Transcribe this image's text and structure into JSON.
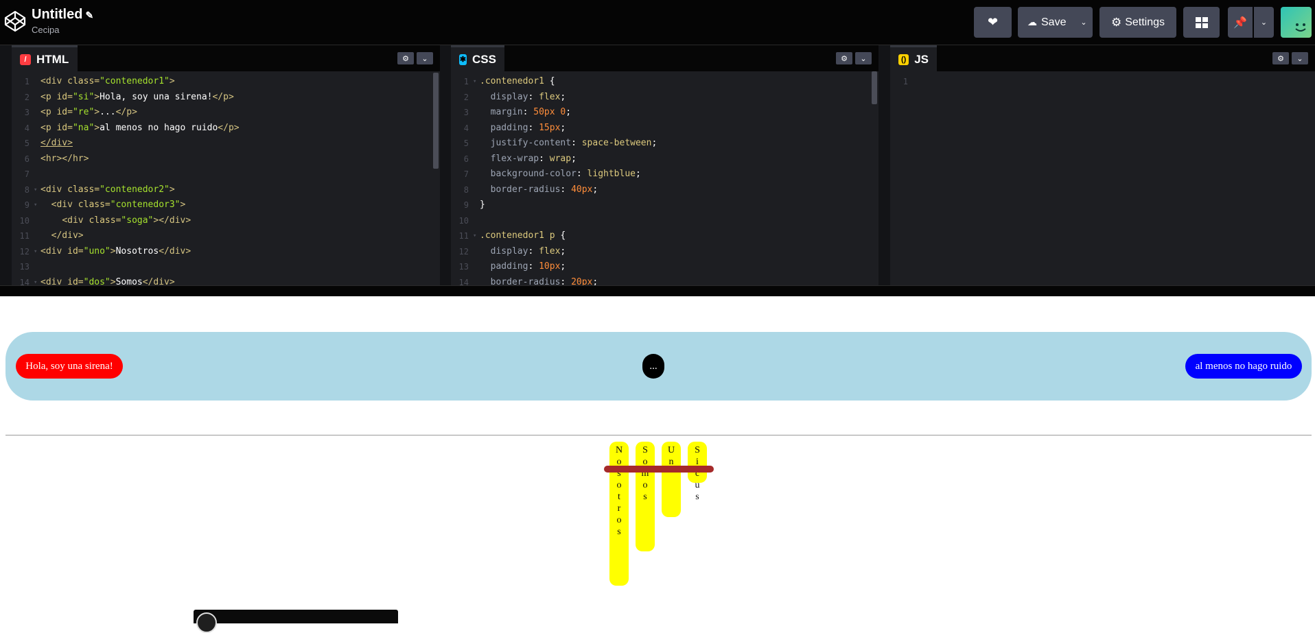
{
  "header": {
    "title": "Untitled",
    "owner": "Cecipa",
    "save_label": "Save",
    "settings_label": "Settings"
  },
  "editors": {
    "html": {
      "label": "HTML",
      "lines": [
        "<div class=\"contenedor1\">",
        "<p id=\"si\">Hola, soy una sirena!</p>",
        "<p id=\"re\">...</p>",
        "<p id=\"na\">al menos no hago ruido</p>",
        "</div>",
        "<hr></hr>",
        "",
        "<div class=\"contenedor2\">",
        "  <div class=\"contenedor3\">",
        "    <div class=\"soga\"></div>",
        "  </div>",
        "<div id=\"uno\">Nosotros</div>",
        "",
        "<div id=\"dos\">Somos</div>"
      ]
    },
    "css": {
      "label": "CSS",
      "lines": [
        ".contenedor1 {",
        "  display: flex;",
        "  margin: 50px 0;",
        "  padding: 15px;",
        "  justify-content: space-between;",
        "  flex-wrap: wrap;",
        "  background-color: lightblue;",
        "  border-radius: 40px;",
        "}",
        "",
        ".contenedor1 p {",
        "  display: flex;",
        "  padding: 10px;",
        "  border-radius: 20px;"
      ]
    },
    "js": {
      "label": "JS",
      "lines": [
        ""
      ]
    }
  },
  "preview": {
    "si_text": "Hola, soy una sirena!",
    "re_text": "...",
    "na_text": "al menos no hago ruido",
    "words": [
      "Nosotros",
      "Somos",
      "Un",
      "Sicus"
    ],
    "colors": {
      "si": "#ff0000",
      "re": "#000000",
      "na": "#0000ff",
      "container": "#add8e6",
      "stick": "#ffff00",
      "rope": "#a52a2a"
    }
  }
}
